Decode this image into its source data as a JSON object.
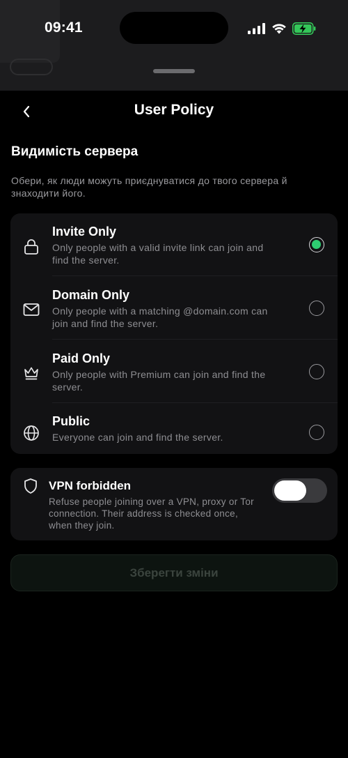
{
  "status_bar": {
    "time": "09:41"
  },
  "header": {
    "title": "User Policy"
  },
  "visibility": {
    "title": "Видимість сервера",
    "description": "Обери, як люди можуть приєднуватися до твого сервера й знаходити його.",
    "options": [
      {
        "label": "Invite Only",
        "description": "Only people with a valid invite link can join and find the server.",
        "icon": "lock-icon",
        "selected": true
      },
      {
        "label": "Domain Only",
        "description": "Only people with a matching @domain.com can join and find the server.",
        "icon": "mail-icon",
        "selected": false
      },
      {
        "label": "Paid Only",
        "description": "Only people with Premium can join and find the server.",
        "icon": "crown-icon",
        "selected": false
      },
      {
        "label": "Public",
        "description": "Everyone can join and find the server.",
        "icon": "globe-icon",
        "selected": false
      }
    ]
  },
  "vpn": {
    "title": "VPN forbidden",
    "description": "Refuse people joining over a VPN, proxy or Tor connection. Their address is checked once, when they join.",
    "enabled": false,
    "icon": "shield-icon"
  },
  "save_button": {
    "label": "Зберегти зміни",
    "enabled": false
  },
  "colors": {
    "accent": "#2ecc71",
    "battery": "#34c759",
    "background": "#000000",
    "card": "#121214"
  }
}
